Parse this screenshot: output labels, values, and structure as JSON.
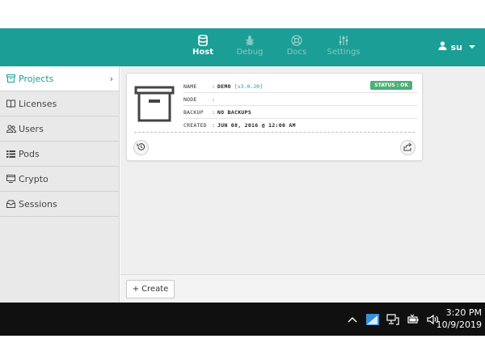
{
  "header": {
    "nav": [
      {
        "label": "Host",
        "icon": "database-icon",
        "active": true
      },
      {
        "label": "Debug",
        "icon": "bug-icon",
        "active": false
      },
      {
        "label": "Docs",
        "icon": "lifebuoy-icon",
        "active": false
      },
      {
        "label": "Settings",
        "icon": "sliders-icon",
        "active": false
      }
    ],
    "user": "su",
    "accent": "#1b9e95"
  },
  "sidebar": {
    "items": [
      {
        "label": "Projects",
        "icon": "projects-icon"
      },
      {
        "label": "Licenses",
        "icon": "book-icon"
      },
      {
        "label": "Users",
        "icon": "users-icon"
      },
      {
        "label": "Pods",
        "icon": "list-icon"
      },
      {
        "label": "Crypto",
        "icon": "monitor-icon"
      },
      {
        "label": "Sessions",
        "icon": "inbox-icon"
      }
    ]
  },
  "card": {
    "name_label": "NAME",
    "name_value": "DEMO",
    "version": "[v3.0.20]",
    "status": "STATUS : OK",
    "node_label": "NODE",
    "node_value": "",
    "backup_label": "BACKUP",
    "backup_value": "NO BACKUPS",
    "created_label": "CREATED",
    "created_value": "JUN 08, 2016 @ 12:00 AM",
    "colon": ":"
  },
  "footer": {
    "create_label": "Create",
    "create_icon": "+"
  },
  "taskbar": {
    "time": "3:20 PM",
    "date": "10/9/2019"
  }
}
